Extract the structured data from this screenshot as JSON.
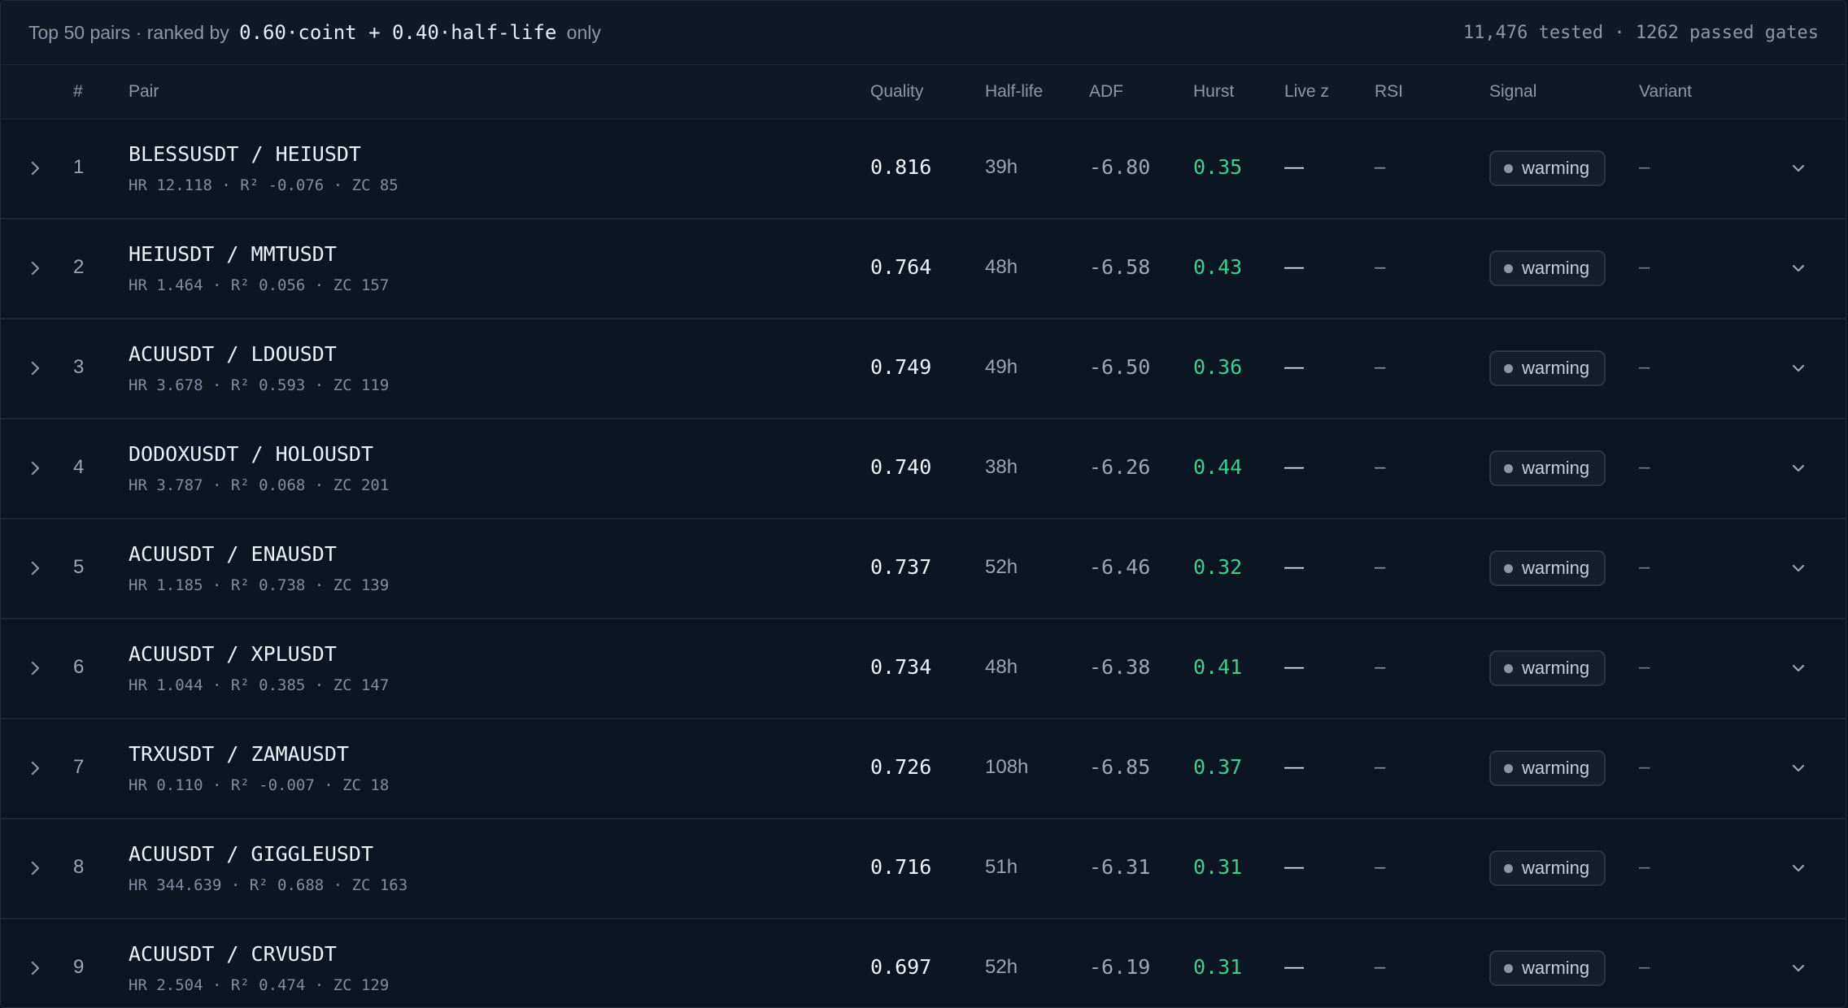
{
  "header": {
    "summary_prefix": "Top 50 pairs · ranked by ",
    "formula": "0.60·coint + 0.40·half-life",
    "summary_suffix": " only",
    "stats": "11,476 tested · 1262 passed gates"
  },
  "columns": {
    "rank": "#",
    "pair": "Pair",
    "quality": "Quality",
    "halflife": "Half-life",
    "adf": "ADF",
    "hurst": "Hurst",
    "livez": "Live z",
    "rsi": "RSI",
    "signal": "Signal",
    "variant": "Variant"
  },
  "colors": {
    "background": "#0c1622",
    "hurst_good": "#3ecf8e",
    "border": "#1b2738"
  },
  "icons": {
    "row_expand": "chevron-right-icon",
    "row_menu": "chevron-down-icon",
    "signal_status": "status-dot-icon"
  },
  "rows": [
    {
      "rank": "1",
      "pair": "BLESSUSDT / HEIUSDT",
      "stats": "HR 12.118 · R² -0.076 · ZC 85",
      "quality": "0.816",
      "halflife": "39h",
      "adf": "-6.80",
      "hurst": "0.35",
      "livez": "—",
      "rsi": "–",
      "signal": "warming",
      "variant": "–"
    },
    {
      "rank": "2",
      "pair": "HEIUSDT / MMTUSDT",
      "stats": "HR 1.464 · R² 0.056 · ZC 157",
      "quality": "0.764",
      "halflife": "48h",
      "adf": "-6.58",
      "hurst": "0.43",
      "livez": "—",
      "rsi": "–",
      "signal": "warming",
      "variant": "–"
    },
    {
      "rank": "3",
      "pair": "ACUUSDT / LDOUSDT",
      "stats": "HR 3.678 · R² 0.593 · ZC 119",
      "quality": "0.749",
      "halflife": "49h",
      "adf": "-6.50",
      "hurst": "0.36",
      "livez": "—",
      "rsi": "–",
      "signal": "warming",
      "variant": "–"
    },
    {
      "rank": "4",
      "pair": "DODOXUSDT / HOLOUSDT",
      "stats": "HR 3.787 · R² 0.068 · ZC 201",
      "quality": "0.740",
      "halflife": "38h",
      "adf": "-6.26",
      "hurst": "0.44",
      "livez": "—",
      "rsi": "–",
      "signal": "warming",
      "variant": "–"
    },
    {
      "rank": "5",
      "pair": "ACUUSDT / ENAUSDT",
      "stats": "HR 1.185 · R² 0.738 · ZC 139",
      "quality": "0.737",
      "halflife": "52h",
      "adf": "-6.46",
      "hurst": "0.32",
      "livez": "—",
      "rsi": "–",
      "signal": "warming",
      "variant": "–"
    },
    {
      "rank": "6",
      "pair": "ACUUSDT / XPLUSDT",
      "stats": "HR 1.044 · R² 0.385 · ZC 147",
      "quality": "0.734",
      "halflife": "48h",
      "adf": "-6.38",
      "hurst": "0.41",
      "livez": "—",
      "rsi": "–",
      "signal": "warming",
      "variant": "–"
    },
    {
      "rank": "7",
      "pair": "TRXUSDT / ZAMAUSDT",
      "stats": "HR 0.110 · R² -0.007 · ZC 18",
      "quality": "0.726",
      "halflife": "108h",
      "adf": "-6.85",
      "hurst": "0.37",
      "livez": "—",
      "rsi": "–",
      "signal": "warming",
      "variant": "–"
    },
    {
      "rank": "8",
      "pair": "ACUUSDT / GIGGLEUSDT",
      "stats": "HR 344.639 · R² 0.688 · ZC 163",
      "quality": "0.716",
      "halflife": "51h",
      "adf": "-6.31",
      "hurst": "0.31",
      "livez": "—",
      "rsi": "–",
      "signal": "warming",
      "variant": "–"
    },
    {
      "rank": "9",
      "pair": "ACUUSDT / CRVUSDT",
      "stats": "HR 2.504 · R² 0.474 · ZC 129",
      "quality": "0.697",
      "halflife": "52h",
      "adf": "-6.19",
      "hurst": "0.31",
      "livez": "—",
      "rsi": "–",
      "signal": "warming",
      "variant": "–"
    }
  ]
}
